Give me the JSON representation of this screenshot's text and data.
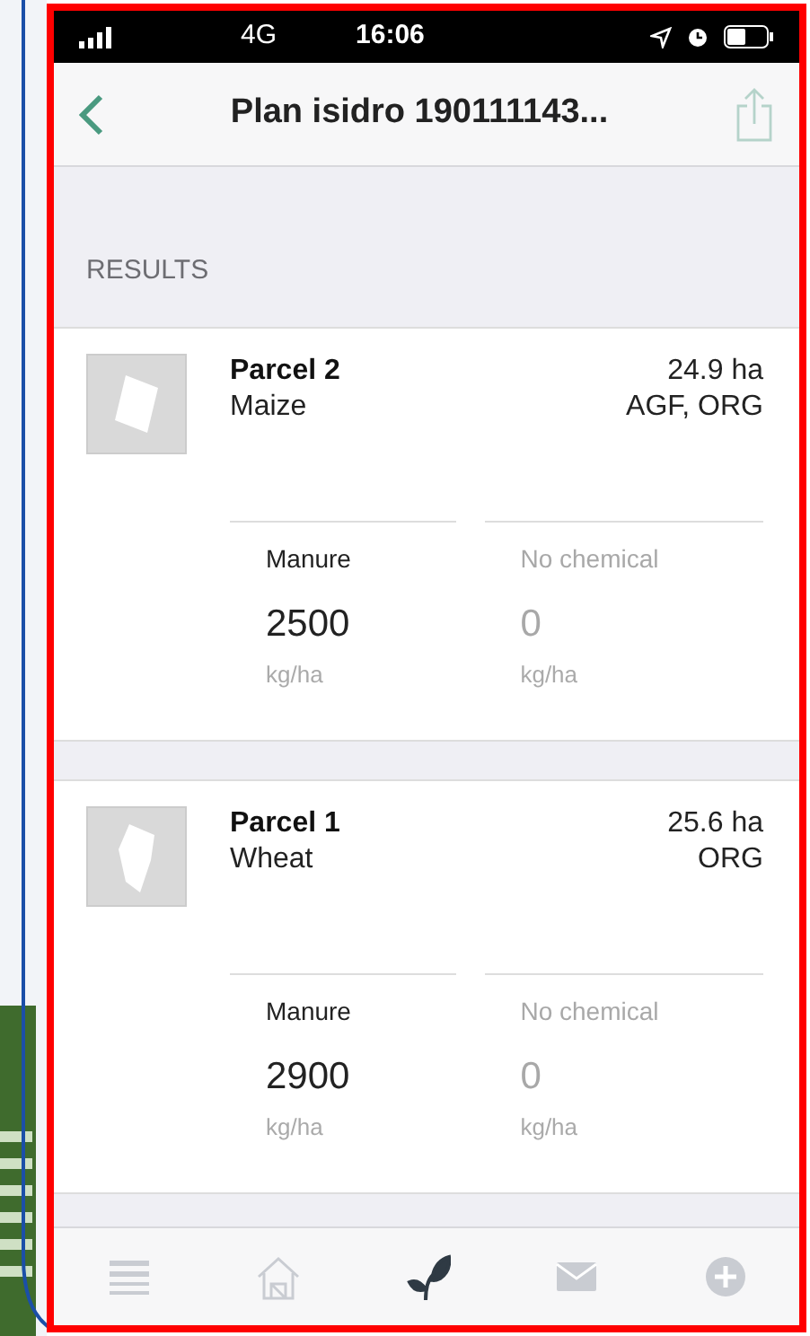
{
  "status_bar": {
    "network": "4G",
    "time": "16:06"
  },
  "nav": {
    "title": "Plan isidro 190111143..."
  },
  "section": {
    "title": "RESULTS"
  },
  "parcels": [
    {
      "name": "Parcel 2",
      "crop": "Maize",
      "area": "24.9 ha",
      "tags": "AGF, ORG",
      "kind": "square",
      "measures": [
        {
          "label": "Manure",
          "value": "2500",
          "unit": "kg/ha",
          "active": true
        },
        {
          "label": "No chemical",
          "value": "0",
          "unit": "kg/ha",
          "active": false
        }
      ]
    },
    {
      "name": "Parcel 1",
      "crop": "Wheat",
      "area": "25.6 ha",
      "tags": "ORG",
      "kind": "strip",
      "measures": [
        {
          "label": "Manure",
          "value": "2900",
          "unit": "kg/ha",
          "active": true
        },
        {
          "label": "No chemical",
          "value": "0",
          "unit": "kg/ha",
          "active": false
        }
      ]
    }
  ],
  "tabs": [
    {
      "kind": "menu",
      "selected": false
    },
    {
      "kind": "farm",
      "selected": false
    },
    {
      "kind": "leaf",
      "selected": true
    },
    {
      "kind": "mail",
      "selected": false
    },
    {
      "kind": "add",
      "selected": false
    }
  ]
}
